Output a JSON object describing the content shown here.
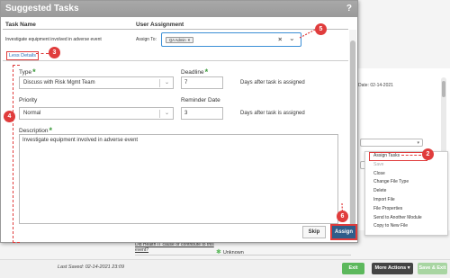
{
  "dialog": {
    "title": "Suggested Tasks",
    "help_icon": "?",
    "headers": {
      "task_name": "Task Name",
      "user_assignment": "User Assignment"
    },
    "task_text": "Investigate equipment involved in adverse event",
    "assign_to_label": "Assign To:",
    "assignee_chip": "QA Admin",
    "less_details": "Less Details",
    "type_label": "Type",
    "type_value": "Discuss with Risk Mgmt Team",
    "deadline_label": "Deadline",
    "deadline_value": "7",
    "days_text_1": "Days after task is assigned",
    "priority_label": "Priority",
    "priority_value": "Normal",
    "reminder_label": "Reminder Date",
    "reminder_value": "3",
    "days_text_2": "Days after task is assigned",
    "description_label": "Description",
    "description_value": "Investigate equipment involved in adverse event",
    "skip_label": "Skip",
    "assign_label": "Assign"
  },
  "background": {
    "date_text": "Date: 02-14-2021",
    "context_menu": [
      "Assign Tasks",
      "Save",
      "Close",
      "Change File Type",
      "Delete",
      "Import File",
      "File Properties",
      "Send to Another Module",
      "Copy to New File"
    ],
    "question": "Did Health IT cause or contribute to this event?",
    "answer": "Unknown",
    "last_saved": "Last Saved: 02-14-2021 23:09",
    "exit_label": "Exit",
    "more_actions_label": "More Actions",
    "save_exit_label": "Save & Exit"
  },
  "annotations": [
    "2",
    "3",
    "4",
    "5",
    "6"
  ],
  "colors": {
    "annotation": "#e03c3c",
    "assign_button": "#2f5d8a",
    "required": "#3a9a3a",
    "link": "#2a6fb8"
  }
}
